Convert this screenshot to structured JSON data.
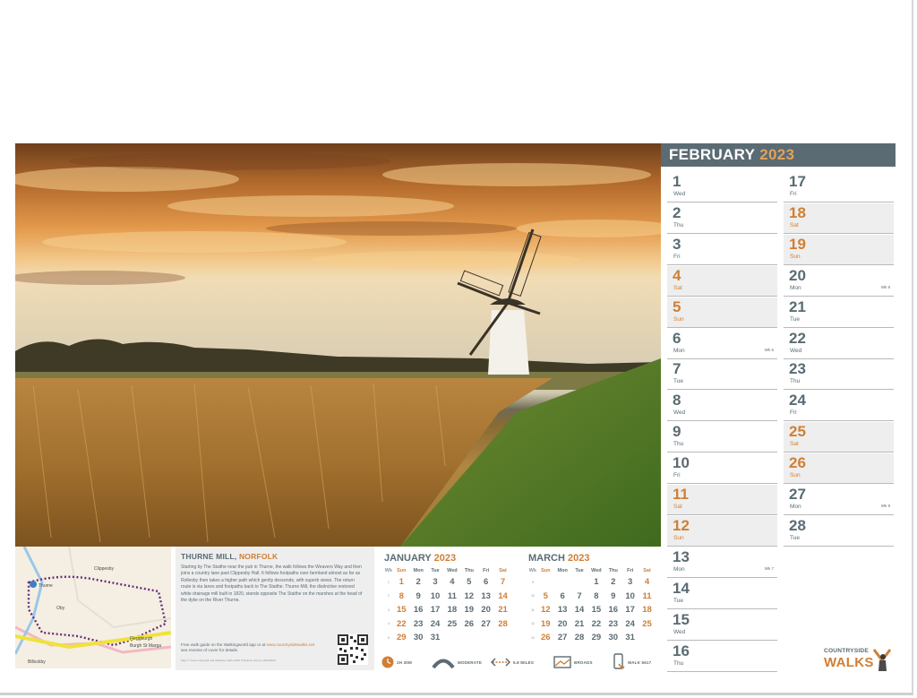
{
  "february": {
    "month": "FEBRUARY",
    "year": "2023",
    "days": [
      {
        "num": "1",
        "wd": "Wed",
        "weekend": false,
        "wk": ""
      },
      {
        "num": "2",
        "wd": "Thu",
        "weekend": false,
        "wk": ""
      },
      {
        "num": "3",
        "wd": "Fri",
        "weekend": false,
        "wk": ""
      },
      {
        "num": "4",
        "wd": "Sat",
        "weekend": true,
        "wk": ""
      },
      {
        "num": "5",
        "wd": "Sun",
        "weekend": true,
        "wk": ""
      },
      {
        "num": "6",
        "wd": "Mon",
        "weekend": false,
        "wk": "Wk 6"
      },
      {
        "num": "7",
        "wd": "Tue",
        "weekend": false,
        "wk": ""
      },
      {
        "num": "8",
        "wd": "Wed",
        "weekend": false,
        "wk": ""
      },
      {
        "num": "9",
        "wd": "Thu",
        "weekend": false,
        "wk": ""
      },
      {
        "num": "10",
        "wd": "Fri",
        "weekend": false,
        "wk": ""
      },
      {
        "num": "11",
        "wd": "Sat",
        "weekend": true,
        "wk": ""
      },
      {
        "num": "12",
        "wd": "Sun",
        "weekend": true,
        "wk": ""
      },
      {
        "num": "13",
        "wd": "Mon",
        "weekend": false,
        "wk": "Wk 7"
      },
      {
        "num": "14",
        "wd": "Tue",
        "weekend": false,
        "wk": ""
      },
      {
        "num": "15",
        "wd": "Wed",
        "weekend": false,
        "wk": ""
      },
      {
        "num": "16",
        "wd": "Thu",
        "weekend": false,
        "wk": ""
      },
      {
        "num": "17",
        "wd": "Fri",
        "weekend": false,
        "wk": ""
      },
      {
        "num": "18",
        "wd": "Sat",
        "weekend": true,
        "wk": ""
      },
      {
        "num": "19",
        "wd": "Sun",
        "weekend": true,
        "wk": ""
      },
      {
        "num": "20",
        "wd": "Mon",
        "weekend": false,
        "wk": "Wk 8"
      },
      {
        "num": "21",
        "wd": "Tue",
        "weekend": false,
        "wk": ""
      },
      {
        "num": "22",
        "wd": "Wed",
        "weekend": false,
        "wk": ""
      },
      {
        "num": "23",
        "wd": "Thu",
        "weekend": false,
        "wk": ""
      },
      {
        "num": "24",
        "wd": "Fri",
        "weekend": false,
        "wk": ""
      },
      {
        "num": "25",
        "wd": "Sat",
        "weekend": true,
        "wk": ""
      },
      {
        "num": "26",
        "wd": "Sun",
        "weekend": true,
        "wk": ""
      },
      {
        "num": "27",
        "wd": "Mon",
        "weekend": false,
        "wk": "Wk 9"
      },
      {
        "num": "28",
        "wd": "Tue",
        "weekend": false,
        "wk": ""
      }
    ]
  },
  "walk": {
    "title": "THURNE MILL,",
    "location": "NORFOLK",
    "description": "Starting by The Staithe near the pub in Thurne, the walk follows the Weavers Way and then joins a country lane past Clippesby Hall. It follows footpaths over farmland almost as far as Rollesby then takes a higher path which gently descends, with superb views. The return route is via lanes and footpaths back to The Staithe. Thurne Mill, the distinctive restored white drainage mill built in 1820, stands opposite The Staithe on the marshes at the head of the dyke on the River Thurne.",
    "guide_prefix": "Free walk guide on the Walkingworld app or at",
    "guide_url": "www.countrysidewalks.net",
    "guide_suffix": "see reverse of cover for details.",
    "copyright": "Map © Crown copyright and database rights 2022 Ordnance Survey 100034631"
  },
  "map_labels": {
    "a": "Thurne",
    "b": "Oby",
    "c": "Clippesby",
    "d": "Billockby",
    "e": "Fleggburgh",
    "f": "Burgh St Marga"
  },
  "mini_calendars": [
    {
      "month": "JANUARY",
      "year": "2023",
      "headers": [
        "Wk",
        "Sun",
        "Mon",
        "Tue",
        "Wed",
        "Thu",
        "Fri",
        "Sat"
      ],
      "rows": [
        [
          "1",
          "1",
          "2",
          "3",
          "4",
          "5",
          "6",
          "7"
        ],
        [
          "2",
          "8",
          "9",
          "10",
          "11",
          "12",
          "13",
          "14"
        ],
        [
          "3",
          "15",
          "16",
          "17",
          "18",
          "19",
          "20",
          "21"
        ],
        [
          "4",
          "22",
          "23",
          "24",
          "25",
          "26",
          "27",
          "28"
        ],
        [
          "5",
          "29",
          "30",
          "31",
          "",
          "",
          "",
          ""
        ]
      ]
    },
    {
      "month": "MARCH",
      "year": "2023",
      "headers": [
        "Wk",
        "Sun",
        "Mon",
        "Tue",
        "Wed",
        "Thu",
        "Fri",
        "Sat"
      ],
      "rows": [
        [
          "9",
          "",
          "",
          "",
          "1",
          "2",
          "3",
          "4"
        ],
        [
          "10",
          "5",
          "6",
          "7",
          "8",
          "9",
          "10",
          "11"
        ],
        [
          "11",
          "12",
          "13",
          "14",
          "15",
          "16",
          "17",
          "18"
        ],
        [
          "12",
          "19",
          "20",
          "21",
          "22",
          "23",
          "24",
          "25"
        ],
        [
          "13",
          "26",
          "27",
          "28",
          "29",
          "30",
          "31",
          ""
        ]
      ]
    }
  ],
  "stats": [
    {
      "icon": "clock-icon",
      "label": "2H 30M"
    },
    {
      "icon": "gradient-icon",
      "label": "MODERATE"
    },
    {
      "icon": "distance-icon",
      "label": "5.8 MILES"
    },
    {
      "icon": "terrain-icon",
      "label": "BROADS"
    },
    {
      "icon": "phone-icon",
      "label": "WALK 5617"
    }
  ],
  "logo": {
    "line1": "COUNTRYSIDE",
    "line2": "WALKS"
  },
  "colors": {
    "slate": "#5a6b73",
    "orange": "#cf7f35",
    "weekend_bg": "#eeeeee"
  }
}
